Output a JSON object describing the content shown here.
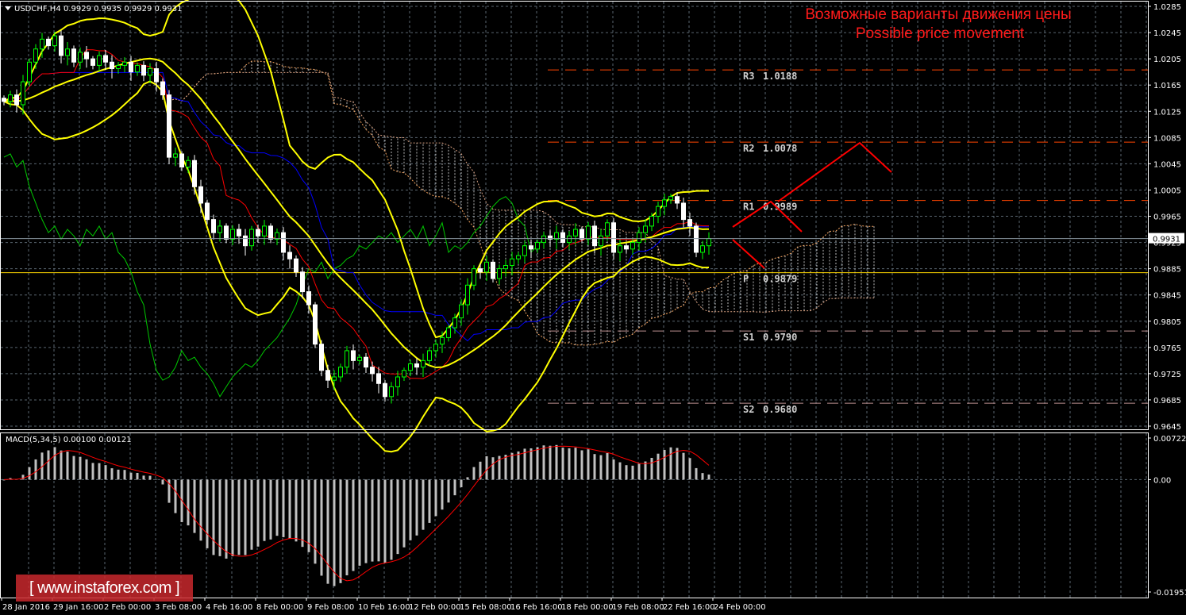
{
  "header": {
    "symbol_timeframe": "USDCHF,H4",
    "ohlc": "0.9929 0.9935 0.9929 0.9931"
  },
  "annotation": {
    "line1": "Возможные варианты движения цены",
    "line2": "Possible price movement",
    "color": "#ff1a1a"
  },
  "watermark": "[ www.instaforex.com ]",
  "chart_data": [
    {
      "type": "candlestick",
      "symbol": "USDCHF",
      "timeframe": "H4",
      "ylim": [
        0.9645,
        1.0285
      ],
      "y_ticks": [
        "1.0285",
        "1.0245",
        "1.0205",
        "1.0165",
        "1.0125",
        "1.0085",
        "1.0045",
        "1.0005",
        "0.9965",
        "0.9925",
        "0.9885",
        "0.9845",
        "0.9805",
        "0.9765",
        "0.9725",
        "0.9685",
        "0.9645"
      ],
      "current_price": "0.9931",
      "x_ticks": [
        "28 Jan 2016",
        "29 Jan 16:00",
        "2 Feb 00:00",
        "3 Feb 08:00",
        "4 Feb 16:00",
        "8 Feb 00:00",
        "9 Feb 08:00",
        "10 Feb 16:00",
        "12 Feb 00:00",
        "15 Feb 08:00",
        "16 Feb 16:00",
        "18 Feb 00:00",
        "19 Feb 08:00",
        "22 Feb 16:00",
        "24 Feb 00:00"
      ],
      "closes": [
        1.014,
        1.015,
        1.0135,
        1.017,
        1.02,
        1.022,
        1.0235,
        1.0225,
        1.024,
        1.021,
        1.022,
        1.02,
        1.0215,
        1.0205,
        1.0195,
        1.021,
        1.02,
        1.019,
        1.0195,
        1.02,
        1.0185,
        1.0195,
        1.018,
        1.019,
        1.017,
        1.015,
        1.0055,
        1.006,
        1.004,
        1.005,
        1.001,
        0.9985,
        0.996,
        0.994,
        0.995,
        0.993,
        0.9945,
        0.9935,
        0.992,
        0.9945,
        0.9935,
        0.995,
        0.993,
        0.994,
        0.991,
        0.99,
        0.988,
        0.985,
        0.983,
        0.977,
        0.973,
        0.9715,
        0.972,
        0.9735,
        0.976,
        0.9745,
        0.975,
        0.9735,
        0.9725,
        0.971,
        0.969,
        0.9705,
        0.972,
        0.973,
        0.974,
        0.9735,
        0.9745,
        0.976,
        0.977,
        0.978,
        0.9795,
        0.981,
        0.983,
        0.986,
        0.9885,
        0.988,
        0.9895,
        0.987,
        0.9885,
        0.989,
        0.99,
        0.9905,
        0.992,
        0.9915,
        0.9925,
        0.9935,
        0.993,
        0.994,
        0.9925,
        0.9935,
        0.9945,
        0.993,
        0.995,
        0.992,
        0.9935,
        0.9955,
        0.991,
        0.992,
        0.9915,
        0.9925,
        0.994,
        0.995,
        0.9965,
        0.998,
        0.999,
        0.9995,
        0.9985,
        0.996,
        0.995,
        0.991,
        0.992,
        0.9931
      ],
      "indicators": [
        "Bollinger Bands",
        "Ichimoku Kinko Hyo"
      ],
      "pivots": [
        {
          "name": "R3",
          "value": "1.0188",
          "color": "#ff4500"
        },
        {
          "name": "R2",
          "value": "1.0078",
          "color": "#ff4500"
        },
        {
          "name": "R1",
          "value": "0.9989",
          "color": "#ff4500"
        },
        {
          "name": "P",
          "value": "0.9879",
          "color": "#ffd700"
        },
        {
          "name": "S1",
          "value": "0.9790",
          "color": "#bc8f8f"
        },
        {
          "name": "S2",
          "value": "0.9680",
          "color": "#bc8f8f"
        }
      ],
      "colors": {
        "bull": "#00ff00",
        "bear": "#ffffff",
        "bands": "#ffff00",
        "tenkan": "#ff0000",
        "kijun": "#0000ff",
        "chikou": "#00c800",
        "cloud": "#f4a460",
        "forecast": "#ff0000"
      }
    },
    {
      "type": "bar",
      "label": "MACD(5,34,5) 0.00100 0.00121",
      "y_ticks": [
        "0.00722",
        "0.00",
        "-0.01951"
      ],
      "ylim": [
        -0.01951,
        0.00722
      ],
      "colors": {
        "histogram": "#c0c0c0",
        "signal": "#ff0000"
      }
    }
  ]
}
